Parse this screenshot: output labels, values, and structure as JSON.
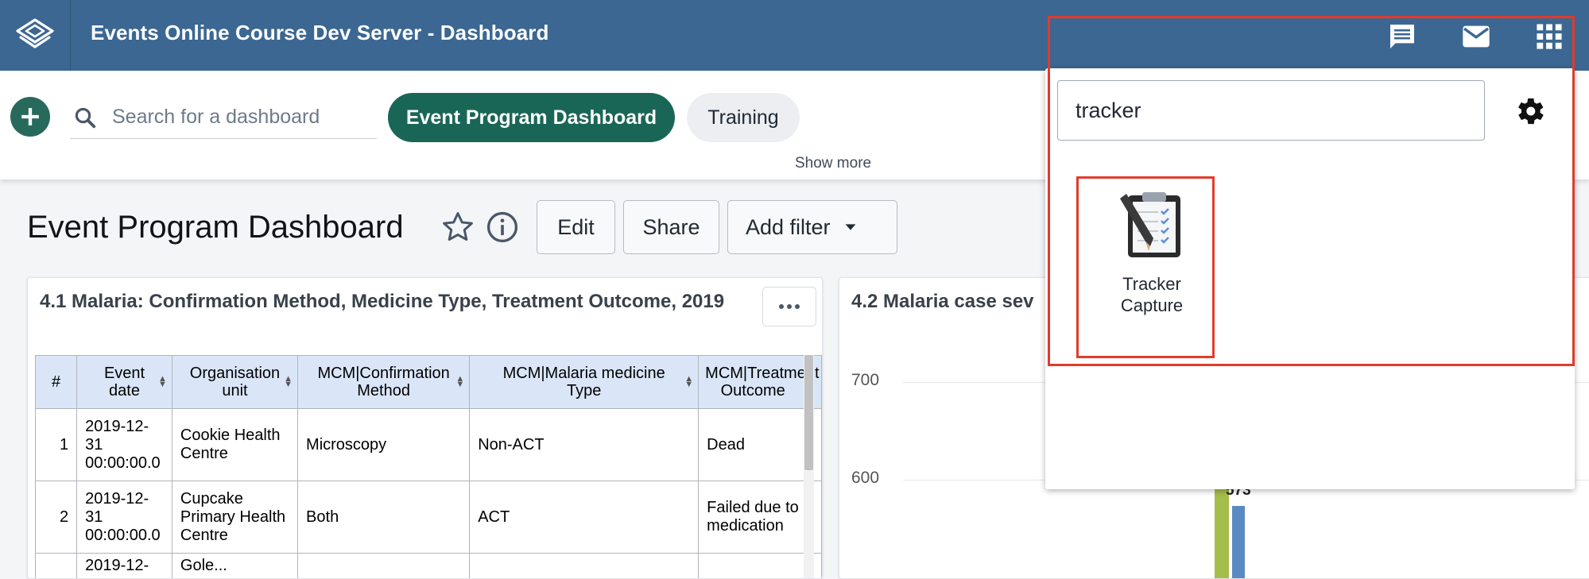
{
  "header": {
    "title": "Events Online Course Dev Server - Dashboard",
    "logo_icon": "dhis2-logo-icon",
    "icons": [
      "interpretations-icon",
      "messages-icon",
      "apps-grid-icon"
    ],
    "bg_color": "#3b6792"
  },
  "dashbar": {
    "search_placeholder": "Search for a dashboard",
    "chips": [
      {
        "label": "Event Program Dashboard",
        "active": true
      },
      {
        "label": "Training",
        "active": false
      }
    ],
    "show_more": "Show more",
    "accent": "#1a6656"
  },
  "dashboard": {
    "title": "Event Program Dashboard",
    "buttons": {
      "edit": "Edit",
      "share": "Share",
      "add_filter": "Add filter"
    }
  },
  "card1": {
    "title": "4.1 Malaria: Confirmation Method, Medicine Type, Treatment Outcome, 2019",
    "columns": [
      "#",
      "Event date",
      "Organisation unit",
      "MCM|Confirmation Method",
      "MCM|Malaria medicine Type",
      "MCM|Treatment Outcome"
    ],
    "rows": [
      {
        "n": "1",
        "date": "2019-12-31 00:00:00.0",
        "org": "Cookie Health Centre",
        "method": "Microscopy",
        "medicine": "Non-ACT",
        "outcome": "Dead"
      },
      {
        "n": "2",
        "date": "2019-12-31 00:00:00.0",
        "org": "Cupcake Primary Health Centre",
        "method": "Both",
        "medicine": "ACT",
        "outcome": "Failed due to medication"
      },
      {
        "n": "",
        "date": "2019-12-",
        "org": "Gole...",
        "method": "",
        "medicine": "",
        "outcome": ""
      }
    ]
  },
  "card2": {
    "title": "4.2 Malaria case sev"
  },
  "chart_data": {
    "type": "bar",
    "title": "4.2 Malaria case sev",
    "yticks": [
      "700",
      "600"
    ],
    "ylim": [
      500,
      700
    ],
    "series": [
      {
        "color": "#a5bd4a",
        "values": [
          600
        ]
      },
      {
        "color": "#5a8ac2",
        "values": [
          573
        ]
      }
    ],
    "data_labels": [
      "573"
    ]
  },
  "app_menu": {
    "search_value": "tracker",
    "apps": [
      {
        "label": "Tracker Capture",
        "icon": "tracker-capture-clipboard-icon"
      }
    ]
  },
  "highlight_color": "#e33b2b"
}
